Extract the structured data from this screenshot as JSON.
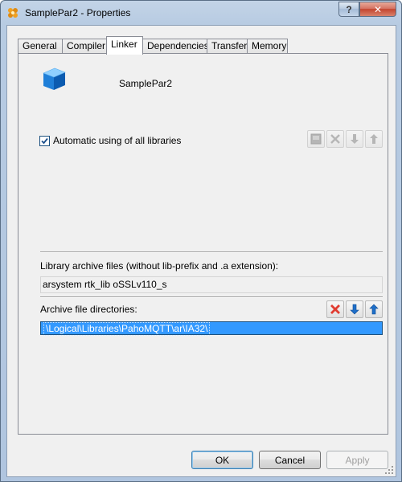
{
  "window": {
    "title": "SamplePar2 - Properties",
    "help_label": "?",
    "close_label": "✕"
  },
  "tabs": [
    {
      "label": "General"
    },
    {
      "label": "Compiler"
    },
    {
      "label": "Linker",
      "active": true
    },
    {
      "label": "Dependencies"
    },
    {
      "label": "Transfer"
    },
    {
      "label": "Memory"
    }
  ],
  "project": {
    "name": "SamplePar2",
    "icon": "blue-cube-icon"
  },
  "linker": {
    "auto_libraries_label": "Automatic using of all libraries",
    "auto_libraries_checked": true,
    "library_files_label": "Library archive files (without lib-prefix and .a extension):",
    "library_files_value": "arsystem rtk_lib oSSLv110_s",
    "archive_dirs_label": "Archive file directories:",
    "archive_dirs": [
      "\\Logical\\Libraries\\PahoMQTT\\ar\\IA32\\"
    ]
  },
  "toolbar_icons": {
    "top": [
      "new-item-icon",
      "delete-icon",
      "move-down-icon",
      "move-up-icon"
    ],
    "bottom": [
      "delete-icon",
      "move-down-icon",
      "move-up-icon"
    ]
  },
  "buttons": {
    "ok": "OK",
    "cancel": "Cancel",
    "apply": "Apply"
  },
  "colors": {
    "selection": "#3399ff",
    "delete_red": "#e03c31",
    "arrow_blue": "#1f6fc9"
  }
}
